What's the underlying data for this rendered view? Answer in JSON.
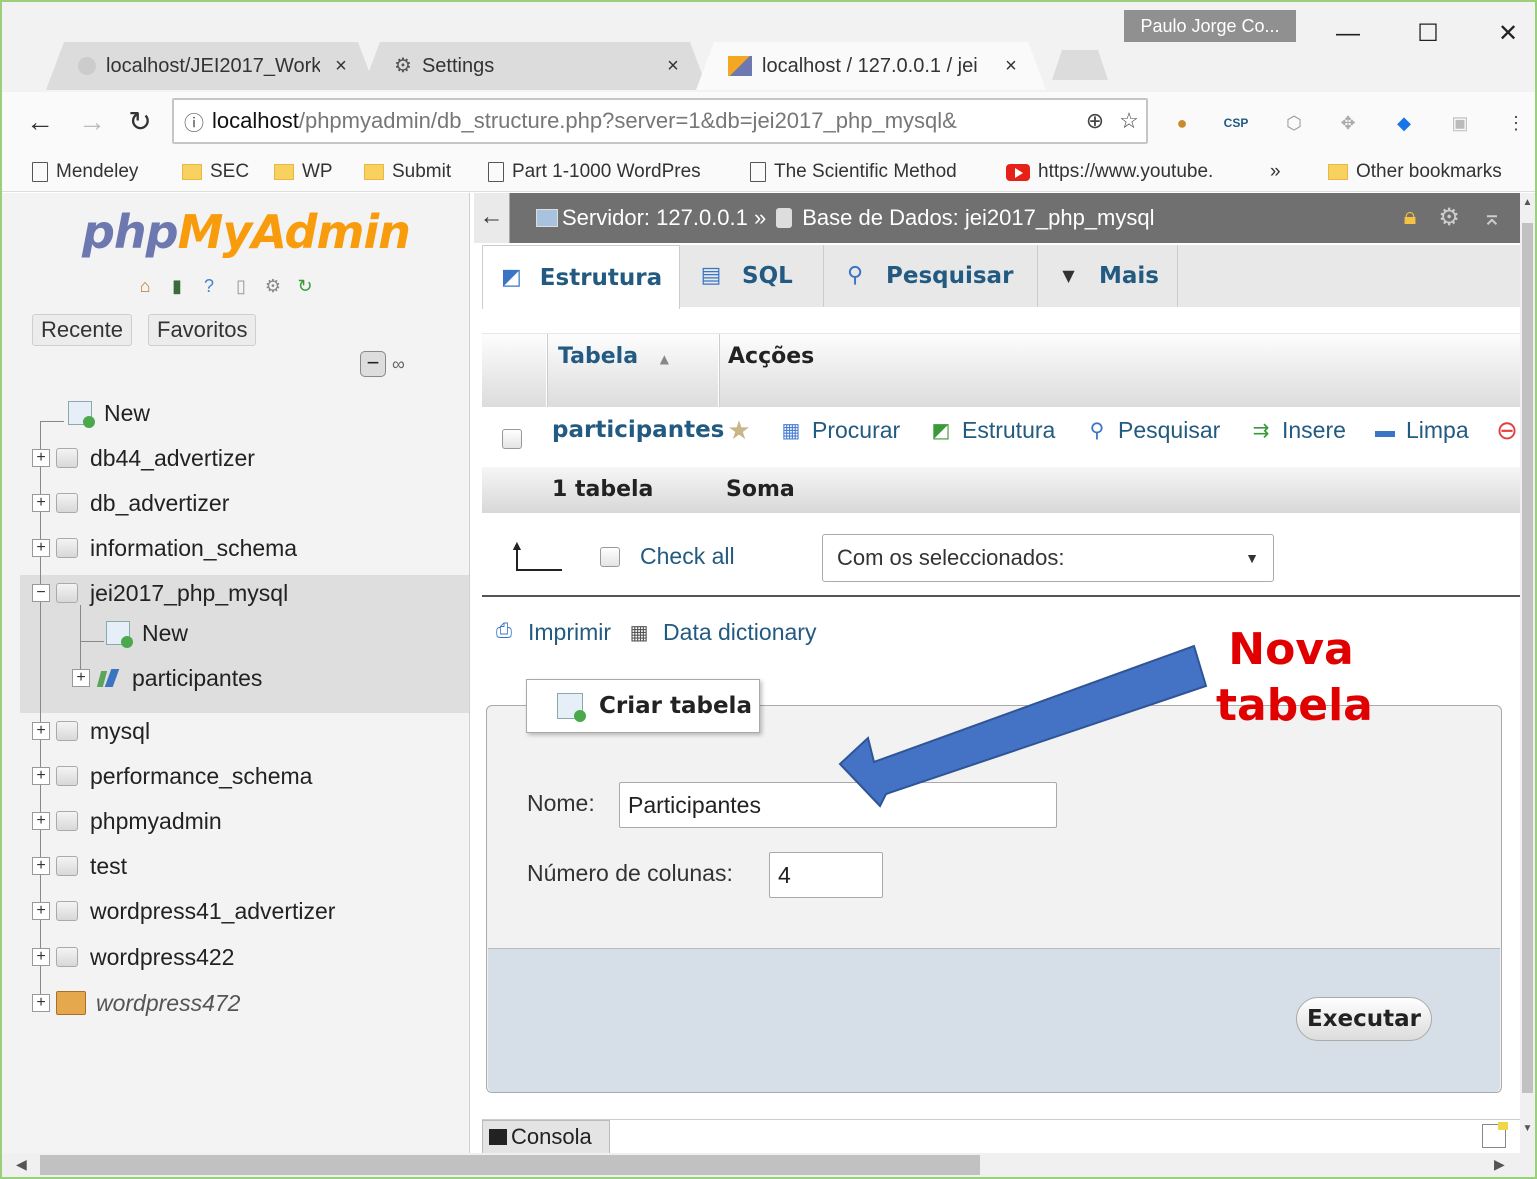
{
  "browser": {
    "profile_name": "Paulo Jorge Co...",
    "tabs": [
      {
        "label": "localhost/JEI2017_Works",
        "close": "×"
      },
      {
        "label": "Settings",
        "close": "×"
      },
      {
        "label": "localhost / 127.0.0.1 / jei",
        "close": "×"
      }
    ],
    "address": {
      "info": "ⓘ",
      "host": "localhost",
      "path": "/phpmyadmin/db_structure.php?server=1&db=jei2017_php_mysql&"
    },
    "window_controls": {
      "minimize": "—",
      "maximize": "☐",
      "close": "✕"
    }
  },
  "bookmarks": [
    {
      "label": "Mendeley",
      "type": "page"
    },
    {
      "label": "SEC",
      "type": "folder"
    },
    {
      "label": "WP",
      "type": "folder"
    },
    {
      "label": "Submit",
      "type": "folder"
    },
    {
      "label": "Part 1-1000 WordPres",
      "type": "page"
    },
    {
      "label": "The Scientific Method",
      "type": "page"
    },
    {
      "label": "https://www.youtube.",
      "type": "youtube"
    },
    {
      "label": "»",
      "type": "more"
    },
    {
      "label": "Other bookmarks",
      "type": "folder"
    }
  ],
  "sidebar": {
    "logo_php": "php",
    "logo_myadmin": "MyAdmin",
    "tabs": [
      "Recente",
      "Favoritos"
    ],
    "tree": [
      {
        "label": "New",
        "icon": "new",
        "expander": ""
      },
      {
        "label": "db44_advertizer",
        "icon": "db",
        "expander": "+"
      },
      {
        "label": "db_advertizer",
        "icon": "db",
        "expander": "+"
      },
      {
        "label": "information_schema",
        "icon": "db",
        "expander": "+"
      },
      {
        "label": "jei2017_php_mysql",
        "icon": "db",
        "expander": "−"
      },
      {
        "label": "New",
        "icon": "new",
        "expander": ""
      },
      {
        "label": "participantes",
        "icon": "table",
        "expander": "+"
      },
      {
        "label": "mysql",
        "icon": "db",
        "expander": "+"
      },
      {
        "label": "performance_schema",
        "icon": "db",
        "expander": "+"
      },
      {
        "label": "phpmyadmin",
        "icon": "db",
        "expander": "+"
      },
      {
        "label": "test",
        "icon": "db",
        "expander": "+"
      },
      {
        "label": "wordpress41_advertizer",
        "icon": "db",
        "expander": "+"
      },
      {
        "label": "wordpress422",
        "icon": "db",
        "expander": "+"
      },
      {
        "label": "wordpress472",
        "icon": "pkg",
        "expander": "+"
      }
    ]
  },
  "breadcrumb": {
    "back": "←",
    "server": "Servidor: 127.0.0.1 »",
    "database": "Base de Dados: jei2017_php_mysql"
  },
  "tabs": [
    {
      "label": "Estrutura",
      "icon": "structure"
    },
    {
      "label": "SQL",
      "icon": "sql"
    },
    {
      "label": "Pesquisar",
      "icon": "search"
    },
    {
      "label": "Mais",
      "icon": "more"
    }
  ],
  "table": {
    "header_table": "Tabela",
    "header_sort": "▲",
    "header_actions": "Acções",
    "row_name": "participantes",
    "actions": [
      "Procurar",
      "Estrutura",
      "Pesquisar",
      "Insere",
      "Limpa"
    ],
    "footer_count": "1 tabela",
    "footer_sum": "Soma"
  },
  "bulk": {
    "check_all": "Check all",
    "with_selected": "Com os seleccionados:",
    "arrow": "▲"
  },
  "links": {
    "print": "Imprimir",
    "data_dictionary": "Data dictionary"
  },
  "create_table": {
    "legend": "Criar tabela",
    "name_label": "Nome:",
    "name_value": "Participantes",
    "columns_label": "Número de colunas:",
    "columns_value": "4",
    "submit": "Executar"
  },
  "console": {
    "label": "Consola"
  },
  "annotation": {
    "line1": "Nova",
    "line2": "tabela",
    "color": "#e00000",
    "arrow_color": "#4472c4"
  }
}
